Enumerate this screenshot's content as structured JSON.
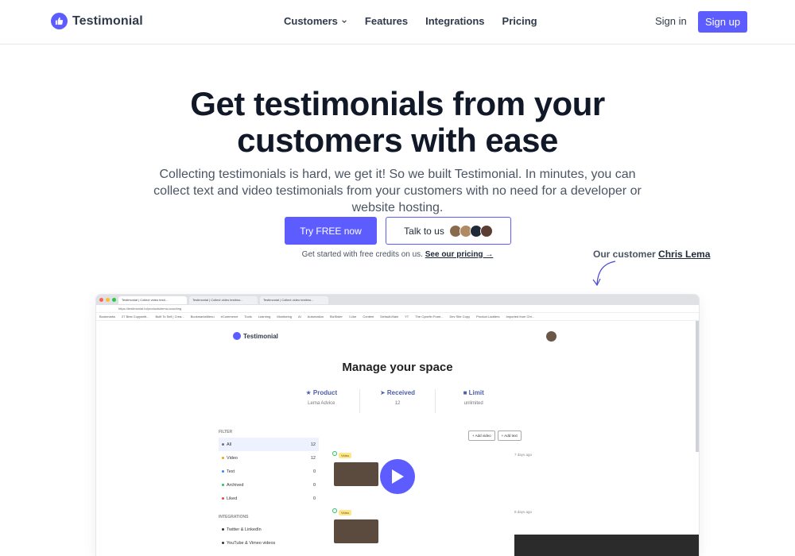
{
  "nav": {
    "brand": "Testimonial",
    "links": [
      {
        "label": "Customers",
        "has_dropdown": true
      },
      {
        "label": "Features"
      },
      {
        "label": "Integrations"
      },
      {
        "label": "Pricing"
      }
    ],
    "signin": "Sign in",
    "signup": "Sign up"
  },
  "hero": {
    "title_line1": "Get testimonials from your",
    "title_line2": "customers with ease",
    "subtitle": "Collecting testimonials is hard, we get it! So we built Testimonial. In minutes, you can collect text and video testimonials from your customers with no need for a developer or website hosting.",
    "cta_primary": "Try FREE now",
    "cta_secondary": "Talk to us",
    "free_note": "Get started with free credits on us.",
    "pricing_link": "See our pricing →",
    "customer_note_prefix": "Our customer",
    "customer_name": "Chris Lema"
  },
  "colors": {
    "brand": "#5d5dff",
    "heading": "#111827",
    "text": "#4b5563"
  },
  "screenshot": {
    "browser_tabs": [
      "Testimonial | Collect video testi...",
      "Testimonial | Collect video testimo...",
      "Testimonial | Collect video testimo..."
    ],
    "address": "https://testimonial.to/products/lema-coaching",
    "bookmarks": [
      "Bookmarks",
      "27 Best Copywriti...",
      "Built To Sell | Crea...",
      "BookmarksMenu",
      "eCommerce",
      "Tools",
      "Learning",
      "Monitoring",
      "AI",
      "Automation",
      "BizSister",
      "I Like",
      "Content",
      "Default-Main",
      "YT",
      "The Cynefin Fram...",
      "Dev Site Copy",
      "Product Ladders",
      "Imported from Chr..."
    ],
    "app_brand": "Testimonial",
    "page_title": "Manage your space",
    "stats": [
      {
        "label": "Product",
        "icon": "star-icon",
        "value": "Lema Advice"
      },
      {
        "label": "Received",
        "icon": "send-icon",
        "value": "12"
      },
      {
        "label": "Limit",
        "icon": "video-icon",
        "value": "unlimited"
      }
    ],
    "filter_heading": "FILTER",
    "filters": [
      {
        "label": "All",
        "count": "12",
        "color": "#6b7280"
      },
      {
        "label": "Video",
        "count": "12",
        "color": "#f59e0b"
      },
      {
        "label": "Text",
        "count": "0",
        "color": "#3b82f6"
      },
      {
        "label": "Archived",
        "count": "0",
        "color": "#22c55e"
      },
      {
        "label": "Liked",
        "count": "0",
        "color": "#ef4444"
      }
    ],
    "integrations_heading": "INTEGRATIONS",
    "integrations": [
      "Twitter & LinkedIn",
      "YouTube & Vimeo videos"
    ],
    "add_video": "+ Add video",
    "add_text": "+ Add text",
    "badge": "Video",
    "time_ago_1": "7 days ago",
    "time_ago_2": "8 days ago"
  }
}
